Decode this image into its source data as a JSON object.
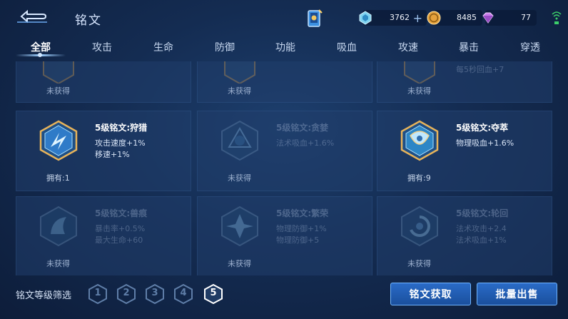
{
  "header": {
    "title": "铭文",
    "diamond": "3762",
    "gold": "8485",
    "gem": "77"
  },
  "tabs": [
    {
      "label": "全部",
      "active": true
    },
    {
      "label": "攻击",
      "active": false
    },
    {
      "label": "生命",
      "active": false
    },
    {
      "label": "防御",
      "active": false
    },
    {
      "label": "功能",
      "active": false
    },
    {
      "label": "吸血",
      "active": false
    },
    {
      "label": "攻速",
      "active": false
    },
    {
      "label": "暴击",
      "active": false
    },
    {
      "label": "穿透",
      "active": false
    }
  ],
  "top_row": [
    {
      "status": "未获得",
      "stat_partial": ""
    },
    {
      "status": "未获得",
      "stat_partial": ""
    },
    {
      "status": "未获得",
      "stat_partial": "每5秒回血+7"
    }
  ],
  "middle_row": [
    {
      "name": "5级铭文:狩猎",
      "stats": [
        "攻击速度+1%",
        "移速+1%"
      ],
      "status": "拥有:1",
      "owned": true
    },
    {
      "name": "5级铭文:贪婪",
      "stats": [
        "法术吸血+1.6%"
      ],
      "status": "未获得",
      "owned": false
    },
    {
      "name": "5级铭文:夺萃",
      "stats": [
        "物理吸血+1.6%"
      ],
      "status": "拥有:9",
      "owned": true
    }
  ],
  "bottom_row": [
    {
      "name": "5级铭文:兽痕",
      "stats": [
        "暴击率+0.5%",
        "最大生命+60"
      ],
      "status": "未获得"
    },
    {
      "name": "5级铭文:繁荣",
      "stats": [
        "物理防御+1%",
        "物理防御+5"
      ],
      "status": "未获得"
    },
    {
      "name": "5级铭文:轮回",
      "stats": [
        "法术攻击+2.4",
        "法术吸血+1%"
      ],
      "status": "未获得"
    }
  ],
  "filter": {
    "label": "铭文等级筛选",
    "levels": [
      "1",
      "2",
      "3",
      "4",
      "5"
    ],
    "selected": "5"
  },
  "buttons": {
    "acquire": "铭文获取",
    "bulk_sell": "批量出售"
  },
  "colors": {
    "accent_blue": "#2a6bc7",
    "background": "#142c52",
    "level_selected": "#ffffff",
    "level_unselected": "#5f7ea8"
  }
}
